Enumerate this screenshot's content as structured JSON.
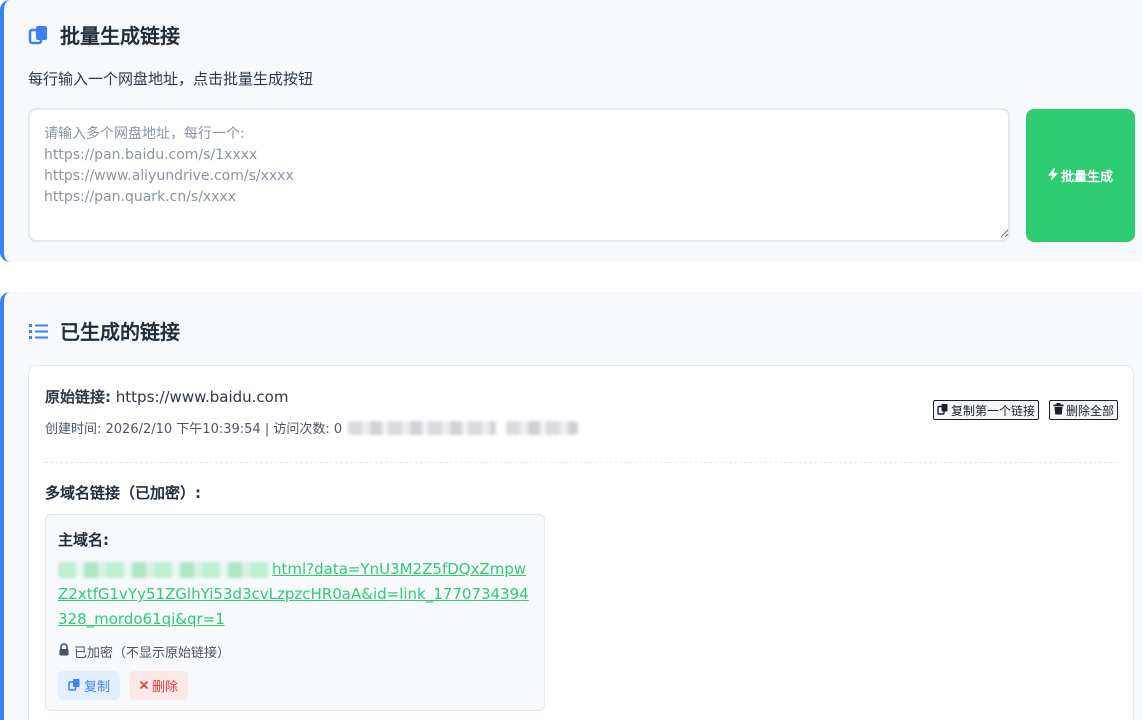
{
  "batch": {
    "title": "批量生成链接",
    "title_icon": "copy-icon",
    "subtitle": "每行输入一个网盘地址，点击批量生成按钮",
    "placeholder": "请输入多个网盘地址，每行一个:\nhttps://pan.baidu.com/s/1xxxx\nhttps://www.aliyundrive.com/s/xxxx\nhttps://pan.quark.cn/s/xxxx",
    "button_label": "批量生成",
    "button_icon": "bolt-icon",
    "button_color": "#2ecc71"
  },
  "list": {
    "title": "已生成的链接",
    "title_icon": "list-icon",
    "accent_color": "#3b82f6",
    "item": {
      "original_label": "原始链接:",
      "original_url": "https://www.baidu.com",
      "meta": "创建时间: 2026/2/10 下午10:39:54 | 访问次数: 0",
      "copy_first_label": "复制第一个链接",
      "delete_all_label": "删除全部",
      "multi_title": "多域名链接（已加密）:",
      "domain_label": "主域名:",
      "link_visible": "html?data=YnU3M2Z5fDQxZmpwZ2xtfG1vYy51ZGlhYi53d3cvLzpzcHR0aA&id=link_1770734394328_mordo61qi&qr=1",
      "encrypted_note": "已加密（不显示原始链接）",
      "copy_label": "复制",
      "delete_label": "删除"
    }
  }
}
